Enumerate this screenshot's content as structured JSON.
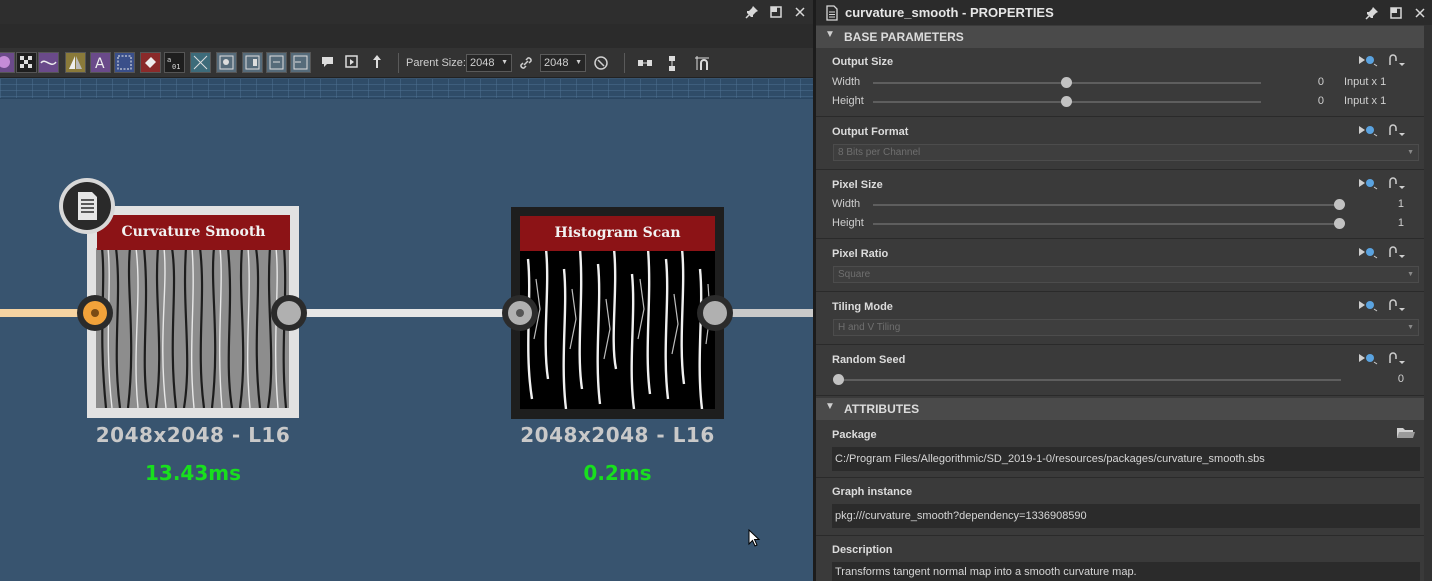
{
  "graph_toolbar": {
    "parent_size_label": "Parent Size:",
    "parent_size_value": "2048",
    "size_value": "2048"
  },
  "nodes": [
    {
      "title": "Curvature Smooth",
      "size": "2048x2048 - L16",
      "time": "13.43ms",
      "icon": "document-icon"
    },
    {
      "title": "Histogram Scan",
      "size": "2048x2048 - L16",
      "time": "0.2ms"
    }
  ],
  "properties": {
    "title": "curvature_smooth - PROPERTIES",
    "base_parameters": {
      "label": "BASE PARAMETERS",
      "output_size": {
        "label": "Output Size",
        "width_label": "Width",
        "width_value": "0",
        "width_suffix": "Input x 1",
        "height_label": "Height",
        "height_value": "0",
        "height_suffix": "Input x 1"
      },
      "output_format": {
        "label": "Output Format",
        "value": "8 Bits per Channel"
      },
      "pixel_size": {
        "label": "Pixel Size",
        "width_label": "Width",
        "width_value": "1",
        "height_label": "Height",
        "height_value": "1"
      },
      "pixel_ratio": {
        "label": "Pixel Ratio",
        "value": "Square"
      },
      "tiling_mode": {
        "label": "Tiling Mode",
        "value": "H and V Tiling"
      },
      "random_seed": {
        "label": "Random Seed",
        "value": "0"
      }
    },
    "attributes": {
      "label": "ATTRIBUTES",
      "package": {
        "label": "Package",
        "value": "C:/Program Files/Allegorithmic/SD_2019-1-0/resources/packages/curvature_smooth.sbs"
      },
      "graph_instance": {
        "label": "Graph instance",
        "value": "pkg:///curvature_smooth?dependency=1336908590"
      },
      "description": {
        "label": "Description",
        "value": "Transforms tangent normal map into a smooth curvature map."
      }
    }
  },
  "colors": {
    "graph_bg": "#38546f",
    "node_title": "#8c1316",
    "timing": "#18e01d",
    "input_port_active": "#f2a23a"
  }
}
